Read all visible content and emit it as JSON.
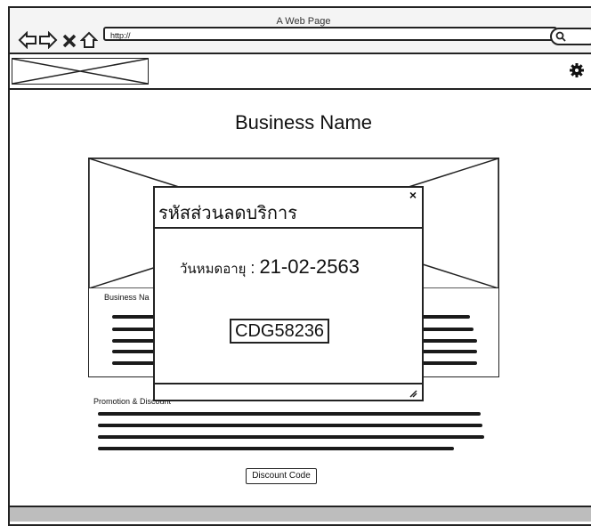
{
  "window": {
    "title": "A Web Page"
  },
  "browser": {
    "url": "http://"
  },
  "page": {
    "business_name": "Business Name",
    "card_heading": "Business Na",
    "promo_heading": "Promotion & Discount",
    "discount_button": "Discount Code"
  },
  "dialog": {
    "title": "รหัสส่วนลดบริการ",
    "expiry_label": "วันหมดอายุ",
    "expiry_sep": " : ",
    "expiry_date": "21-02-2563",
    "code": "CDG58236",
    "close_glyph": "×"
  },
  "icons": {
    "back": "back-arrow-icon",
    "forward": "forward-arrow-icon",
    "stop": "close-icon",
    "home": "home-icon",
    "search": "search-icon",
    "settings": "gear-icon",
    "resize": "resize-icon"
  }
}
